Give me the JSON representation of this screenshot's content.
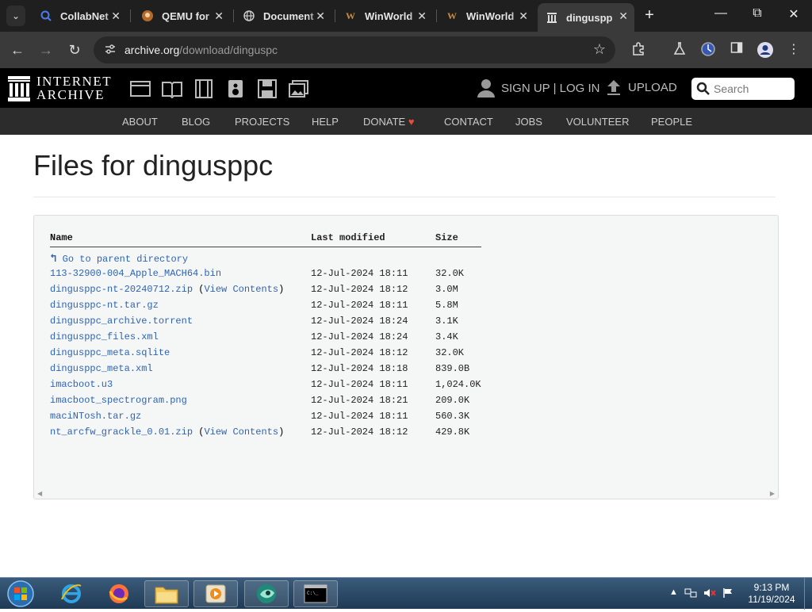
{
  "browser": {
    "tabs": [
      {
        "label": "CollabNet",
        "icon": "search-icon"
      },
      {
        "label": "QEMU for",
        "icon": "qemu-icon"
      },
      {
        "label": "Document",
        "icon": "globe-icon"
      },
      {
        "label": "WinWorld",
        "icon": "winworld-icon"
      },
      {
        "label": "WinWorld",
        "icon": "winworld-icon"
      },
      {
        "label": "dinguspp",
        "icon": "archive-icon"
      }
    ],
    "url_host": "archive.org",
    "url_path": "/download/dinguspc",
    "accent": "#1f1f1f"
  },
  "ia": {
    "wordmark_line1": "INTERNET",
    "wordmark_line2": "ARCHIVE",
    "user_label": "SIGN UP | LOG IN",
    "upload_label": "UPLOAD",
    "search_placeholder": "Search",
    "nav": [
      "ABOUT",
      "BLOG",
      "PROJECTS",
      "HELP",
      "DONATE",
      "CONTACT",
      "JOBS",
      "VOLUNTEER",
      "PEOPLE"
    ],
    "donate_color": "#e74c3c"
  },
  "page": {
    "title": "Files for dingusppc",
    "headers": {
      "name": "Name",
      "modified": "Last modified",
      "size": "Size"
    },
    "parent_label": "Go to parent directory",
    "files": [
      {
        "name": "113-32900-004_Apple_MACH64.bin",
        "extra": "",
        "modified": "12-Jul-2024 18:11",
        "size": "32.0K"
      },
      {
        "name": "dingusppc-nt-20240712.zip",
        "extra": "View Contents",
        "modified": "12-Jul-2024 18:12",
        "size": "3.0M"
      },
      {
        "name": "dingusppc-nt.tar.gz",
        "extra": "",
        "modified": "12-Jul-2024 18:11",
        "size": "5.8M"
      },
      {
        "name": "dingusppc_archive.torrent",
        "extra": "",
        "modified": "12-Jul-2024 18:24",
        "size": "3.1K"
      },
      {
        "name": "dingusppc_files.xml",
        "extra": "",
        "modified": "12-Jul-2024 18:24",
        "size": "3.4K"
      },
      {
        "name": "dingusppc_meta.sqlite",
        "extra": "",
        "modified": "12-Jul-2024 18:12",
        "size": "32.0K"
      },
      {
        "name": "dingusppc_meta.xml",
        "extra": "",
        "modified": "12-Jul-2024 18:18",
        "size": "839.0B"
      },
      {
        "name": "imacboot.u3",
        "extra": "",
        "modified": "12-Jul-2024 18:11",
        "size": "1,024.0K"
      },
      {
        "name": "imacboot_spectrogram.png",
        "extra": "",
        "modified": "12-Jul-2024 18:21",
        "size": "209.0K"
      },
      {
        "name": "maciNTosh.tar.gz",
        "extra": "",
        "modified": "12-Jul-2024 18:11",
        "size": "560.3K"
      },
      {
        "name": "nt_arcfw_grackle_0.01.zip",
        "extra": "View Contents",
        "modified": "12-Jul-2024 18:12",
        "size": "429.8K"
      }
    ],
    "link_color": "#2f64b3"
  },
  "taskbar": {
    "apps": [
      "internet-explorer-icon",
      "firefox-icon",
      "explorer-icon",
      "media-player-icon",
      "app-icon",
      "cmd-icon"
    ],
    "time": "9:13 PM",
    "date": "11/19/2024"
  }
}
